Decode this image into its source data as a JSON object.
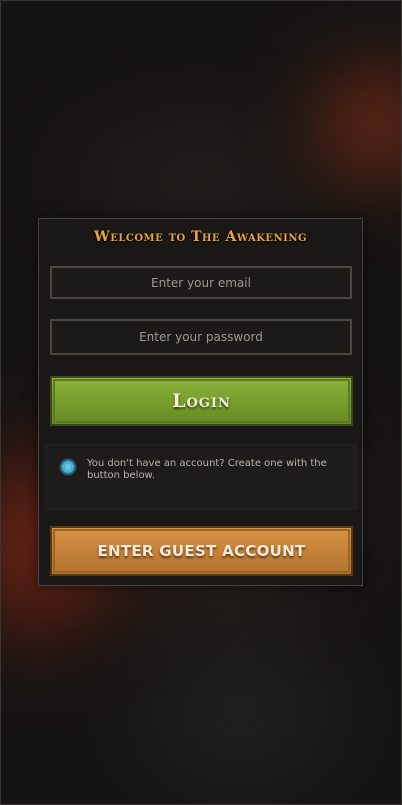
{
  "login": {
    "title": "Welcome to The Awakening",
    "email": {
      "value": "",
      "placeholder": "Enter your email"
    },
    "password": {
      "value": "",
      "placeholder": "Enter your password"
    },
    "login_button_label": "Login",
    "notice_text": "You don't have an account? Create one with the button below.",
    "guest_button_label": "ENTER GUEST ACCOUNT"
  },
  "colors": {
    "title": "#e8a53a",
    "login_button": "#7aa02f",
    "guest_button": "#c7843a",
    "notice_dot": "#47b2d2",
    "panel_bg": "#1a1817"
  },
  "icons": {
    "notice": "info-dot-icon"
  }
}
